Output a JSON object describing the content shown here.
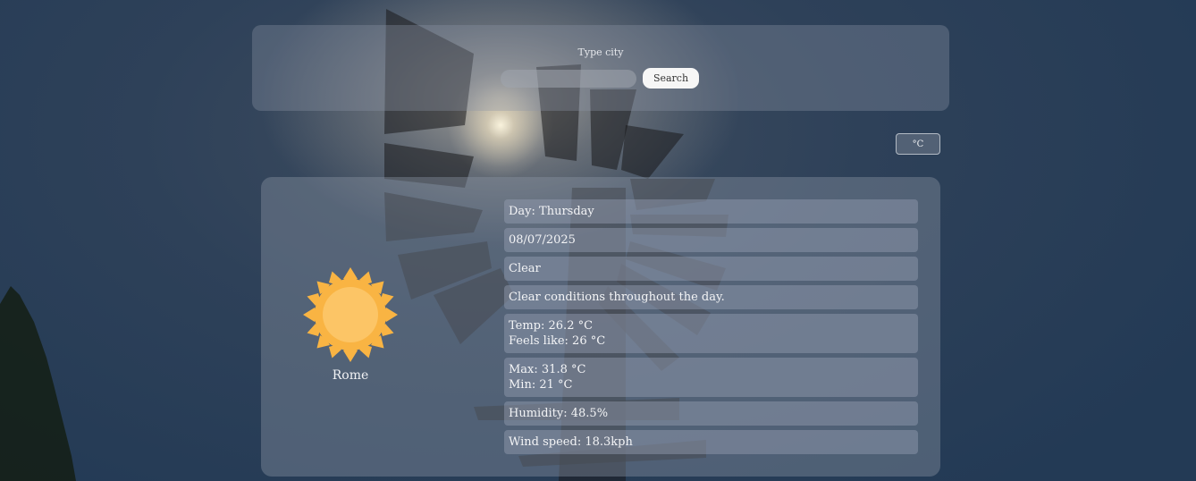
{
  "search": {
    "label": "Type city",
    "placeholder": "",
    "value": "",
    "button_label": "Search"
  },
  "unit_toggle": {
    "label": "°C"
  },
  "weather": {
    "city": "Rome",
    "icon": "sun-icon",
    "day": "Day: Thursday",
    "date": "08/07/2025",
    "condition": "Clear",
    "description": "Clear conditions throughout the day.",
    "temp": "Temp: 26.2 °C",
    "feels_like": "Feels like: 26 °C",
    "max": "Max: 31.8 °C",
    "min": "Min: 21 °C",
    "humidity": "Humidity: 48.5%",
    "wind": "Wind speed: 18.3kph"
  },
  "colors": {
    "sun_outer": "#f9b443",
    "sun_inner": "#fcc566",
    "background": "#2e4159"
  }
}
